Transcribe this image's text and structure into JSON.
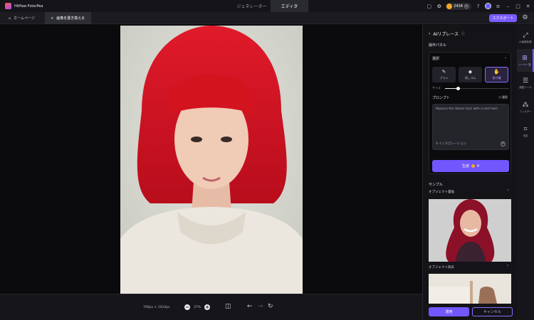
{
  "app": {
    "name": "HitPaw FotorPea"
  },
  "mode_tabs": [
    {
      "label": "ジェネレーター",
      "active": false
    },
    {
      "label": "エディタ",
      "active": true
    }
  ],
  "header": {
    "credits": "2434"
  },
  "tabs": [
    {
      "label": "ホームページ"
    },
    {
      "label": "画像を置き換える"
    }
  ],
  "export_label": "エクスポート",
  "canvas": {
    "dimensions": "768px × 1024px",
    "zoom": "37%"
  },
  "panel": {
    "title": "AIリプレース",
    "section_label": "操作パネル",
    "select_label": "選択",
    "tools": [
      {
        "label": "ブラシ",
        "icon": "brush-icon",
        "active": false
      },
      {
        "label": "消しゴム",
        "icon": "eraser-icon",
        "active": false
      },
      {
        "label": "投げ縄",
        "icon": "lasso-icon",
        "active": true
      }
    ],
    "size_label": "サイズ",
    "size_value": 0.2,
    "prompt_label": "プロンプト",
    "history_label": "履歴",
    "prompt_text": "Replace the (black hair) with a (red hair)",
    "inspire_label": "インスピレーション",
    "generate_label": "生成",
    "generate_cost": "4",
    "sample_label": "サンプル",
    "samples": [
      {
        "label": "オブジェクト置換"
      },
      {
        "label": "オブジェクト除去"
      }
    ],
    "apply_label": "適用",
    "cancel_label": "キャンセル"
  },
  "rail": [
    {
      "label": "AI画像拡張",
      "icon": "expand-icon",
      "active": false
    },
    {
      "label": "ツール一覧",
      "icon": "grid-icon",
      "active": true
    },
    {
      "label": "調整ツール",
      "icon": "sliders-icon",
      "active": false
    },
    {
      "label": "フィルター",
      "icon": "filter-icon",
      "active": false
    },
    {
      "label": "切抜",
      "icon": "crop-icon",
      "active": false
    }
  ]
}
